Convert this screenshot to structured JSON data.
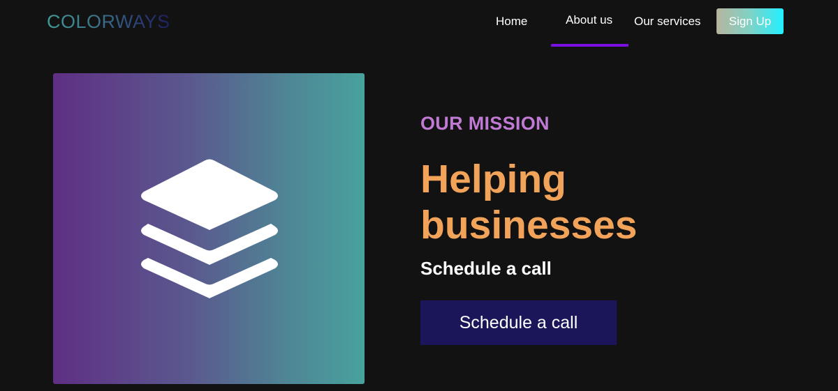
{
  "header": {
    "logo_text": "COLORWAYS",
    "nav": {
      "home": "Home",
      "about": "About us",
      "services": "Our services"
    },
    "active_nav": "About us",
    "signup_label": "Sign Up"
  },
  "hero": {
    "image_icon": "layers-icon",
    "eyebrow": "OUR MISSION",
    "headline": "Helping businesses",
    "subheading": "Schedule a call",
    "cta_label": "Schedule a call"
  },
  "colors": {
    "background": "#121212",
    "nav_active_underline": "#7a10e0",
    "eyebrow": "#c07ad4",
    "headline": "#f2a35a",
    "cta_background": "#1a1659",
    "image_gradient_start": "#5f2f84",
    "image_gradient_end": "#48a29d",
    "signup_gradient_end": "#21f0ff"
  }
}
